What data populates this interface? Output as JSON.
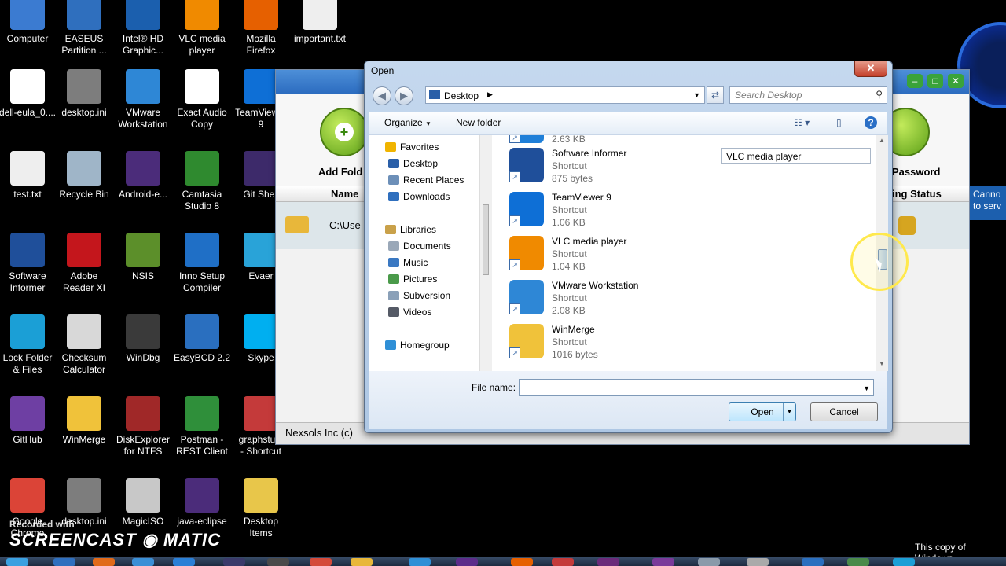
{
  "desktop": {
    "icons": [
      {
        "label": "Computer",
        "icon": "computer-icon",
        "color": "#3b7bd1"
      },
      {
        "label": "EASEUS\nPartition ...",
        "icon": "easeus-icon",
        "color": "#2f6fbe"
      },
      {
        "label": "Intel® HD\nGraphic...",
        "icon": "intel-icon",
        "color": "#1b5fae"
      },
      {
        "label": "VLC media\nplayer",
        "icon": "vlc-icon",
        "color": "#f08a00"
      },
      {
        "label": "Mozilla\nFirefox",
        "icon": "firefox-icon",
        "color": "#e66000"
      },
      {
        "label": "important.txt",
        "icon": "text-file-icon",
        "color": "#eeeeee"
      },
      {
        "label": "dell-eula_0....",
        "icon": "document-icon",
        "color": "#ffffff"
      },
      {
        "label": "desktop.ini",
        "icon": "settings-file-icon",
        "color": "#7d7d7d"
      },
      {
        "label": "VMware\nWorkstation",
        "icon": "vmware-icon",
        "color": "#2e87d6"
      },
      {
        "label": "Exact Audio\nCopy",
        "icon": "eac-icon",
        "color": "#ffffff"
      },
      {
        "label": "TeamViewer\n9",
        "icon": "teamviewer-icon",
        "color": "#0e6fd6"
      },
      {
        "label": "test.txt",
        "icon": "text-file-icon",
        "color": "#eeeeee"
      },
      {
        "label": "Recycle Bin",
        "icon": "recycle-bin-icon",
        "color": "#9fb5c8"
      },
      {
        "label": "Android-e...",
        "icon": "eclipse-icon",
        "color": "#4b2c7a"
      },
      {
        "label": "Camtasia\nStudio 8",
        "icon": "camtasia-icon",
        "color": "#2f8a2f"
      },
      {
        "label": "Git Shell",
        "icon": "git-shell-icon",
        "color": "#3d2a6a"
      },
      {
        "label": "Software\nInformer",
        "icon": "software-informer-icon",
        "color": "#1f4f9a"
      },
      {
        "label": "Adobe\nReader XI",
        "icon": "adobe-reader-icon",
        "color": "#c4161c"
      },
      {
        "label": "NSIS",
        "icon": "nsis-icon",
        "color": "#5c8f2a"
      },
      {
        "label": "Inno Setup\nCompiler",
        "icon": "inno-setup-icon",
        "color": "#1f6fc6"
      },
      {
        "label": "Evaer",
        "icon": "evaer-icon",
        "color": "#29a3d8"
      },
      {
        "label": "Lock Folder\n& Files",
        "icon": "lock-folder-icon",
        "color": "#1b9fd6"
      },
      {
        "label": "Checksum\nCalculator",
        "icon": "calculator-icon",
        "color": "#d8d8d8"
      },
      {
        "label": "WinDbg",
        "icon": "windbg-icon",
        "color": "#3a3a3a"
      },
      {
        "label": "EasyBCD 2.2",
        "icon": "easybcd-icon",
        "color": "#2a6fbf"
      },
      {
        "label": "Skype",
        "icon": "skype-icon",
        "color": "#00aff0"
      },
      {
        "label": "GitHub",
        "icon": "github-icon",
        "color": "#6e3fa3"
      },
      {
        "label": "WinMerge",
        "icon": "winmerge-icon",
        "color": "#f0c23a"
      },
      {
        "label": "DiskExplorer\nfor NTFS",
        "icon": "disk-explorer-icon",
        "color": "#a02828"
      },
      {
        "label": "Postman -\nREST Client",
        "icon": "postman-icon",
        "color": "#2f8f3a"
      },
      {
        "label": "graphstu...\n- Shortcut",
        "icon": "graph-icon",
        "color": "#c43a3a"
      },
      {
        "label": "Google\nChrome",
        "icon": "chrome-icon",
        "color": "#db4437"
      },
      {
        "label": "desktop.ini",
        "icon": "settings-file-icon",
        "color": "#7d7d7d"
      },
      {
        "label": "MagicISO",
        "icon": "magiciso-icon",
        "color": "#c8c8c8"
      },
      {
        "label": "java-eclipse",
        "icon": "eclipse-icon",
        "color": "#4b2c7a"
      },
      {
        "label": "Desktop\nItems",
        "icon": "folder-icon",
        "color": "#e8c64a"
      }
    ]
  },
  "app_window": {
    "toolbar_left_label": "Add Fold",
    "toolbar_right_label": "Password",
    "column_name": "Name",
    "column_status": "ing Status",
    "row_path": "C:\\Use",
    "status_text": "Nexsols Inc (c)",
    "tooltip": "Canno\nto serv"
  },
  "dialog": {
    "title": "Open",
    "close_label": "✕",
    "address": "Desktop",
    "search_placeholder": "Search Desktop",
    "organize_label": "Organize",
    "new_folder_label": "New folder",
    "nav": [
      {
        "label": "Favorites",
        "icon": "star-icon",
        "color": "#f0b400"
      },
      {
        "label": "Desktop",
        "icon": "desktop-icon",
        "color": "#2a5fa8"
      },
      {
        "label": "Recent Places",
        "icon": "recent-places-icon",
        "color": "#6c8fb8"
      },
      {
        "label": "Downloads",
        "icon": "downloads-icon",
        "color": "#2f6fbe"
      },
      {
        "label": "Libraries",
        "icon": "libraries-icon",
        "color": "#c9a14a"
      },
      {
        "label": "Documents",
        "icon": "documents-icon",
        "color": "#9aa8b8"
      },
      {
        "label": "Music",
        "icon": "music-icon",
        "color": "#3a78c2"
      },
      {
        "label": "Pictures",
        "icon": "pictures-icon",
        "color": "#4a9a4a"
      },
      {
        "label": "Subversion",
        "icon": "subversion-icon",
        "color": "#8aa0b8"
      },
      {
        "label": "Videos",
        "icon": "videos-icon",
        "color": "#555a66"
      },
      {
        "label": "Homegroup",
        "icon": "homegroup-icon",
        "color": "#2f8fd6"
      }
    ],
    "files": [
      {
        "name": "",
        "type": "Shortcut",
        "size": "2.63 KB",
        "icon": "shortcut-icon",
        "color": "#1f7fd8"
      },
      {
        "name": "Software Informer",
        "type": "Shortcut",
        "size": "875 bytes",
        "icon": "software-informer-icon",
        "color": "#1f4f9a"
      },
      {
        "name": "TeamViewer 9",
        "type": "Shortcut",
        "size": "1.06 KB",
        "icon": "teamviewer-icon",
        "color": "#0e6fd6"
      },
      {
        "name": "VLC media player",
        "type": "Shortcut",
        "size": "1.04 KB",
        "icon": "vlc-icon",
        "color": "#f08a00"
      },
      {
        "name": "VMware Workstation",
        "type": "Shortcut",
        "size": "2.08 KB",
        "icon": "vmware-icon",
        "color": "#2e87d6"
      },
      {
        "name": "WinMerge",
        "type": "Shortcut",
        "size": "1016 bytes",
        "icon": "winmerge-icon",
        "color": "#f0c23a"
      }
    ],
    "rename_box": "VLC media player",
    "file_name_label": "File name:",
    "file_name_value": "",
    "open_label": "Open",
    "cancel_label": "Cancel"
  },
  "watermark": {
    "recorded": "Recorded with",
    "brand": "SCREENCAST ◉ MATIC"
  },
  "windows_notice": "This copy of Windows"
}
